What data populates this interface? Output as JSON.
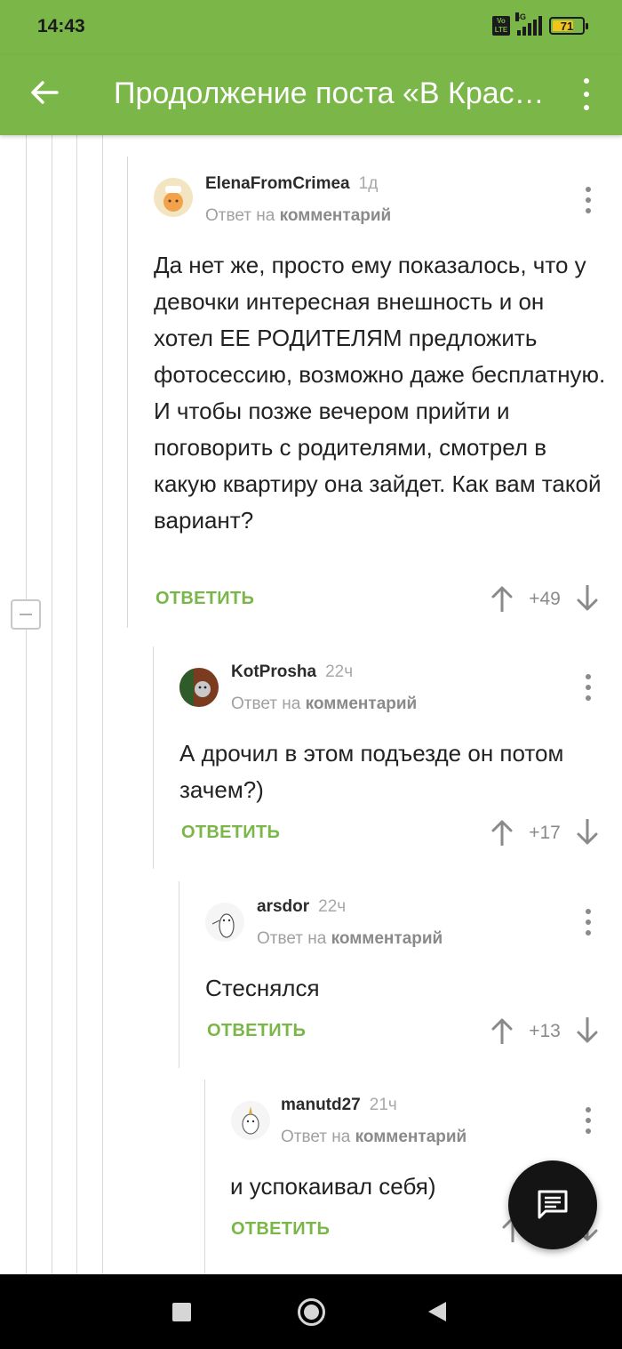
{
  "status_bar": {
    "time": "14:43",
    "volte": "Vo LTE",
    "network": "4G",
    "battery": "71",
    "battery_level": 0.71
  },
  "app_bar": {
    "title": "Продолжение поста «В Краснодаре задержали мужчину, который следил за девочкой»",
    "back_icon": "arrow-left-icon",
    "menu_icon": "more-vert-icon"
  },
  "comments": [
    {
      "author": "ElenaFromCrimea",
      "age": "1д",
      "reply_prefix": "Ответ на",
      "reply_target": "комментарий",
      "text": "Да нет же, просто ему показалось, что у девочки интересная внешность и он хотел ЕЕ РОДИТЕЛЯМ предложить фотосессию, возможно даже бесплатную. И чтобы позже вечером прийти и поговорить с родителями, смотрел в какую квартиру она зайдет. Как вам такой вариант?",
      "reply_label": "ОТВЕТИТЬ",
      "rating": "+49"
    },
    {
      "author": "KotProsha",
      "age": "22ч",
      "reply_prefix": "Ответ на",
      "reply_target": "комментарий",
      "text": "А дрочил в этом подъезде он потом зачем?)",
      "reply_label": "ОТВЕТИТЬ",
      "rating": "+17"
    },
    {
      "author": "arsdor",
      "age": "22ч",
      "reply_prefix": "Ответ на",
      "reply_target": "комментарий",
      "text": "Стеснялся",
      "reply_label": "ОТВЕТИТЬ",
      "rating": "+13"
    },
    {
      "author": "manutd27",
      "age": "21ч",
      "reply_prefix": "Ответ на",
      "reply_target": "комментарий",
      "text": "и успокаивал себя)",
      "reply_label": "ОТВЕТИТЬ",
      "rating": ""
    }
  ],
  "fab": {
    "icon": "comment-icon"
  },
  "nav_bar": {
    "icons": [
      "recents-square-icon",
      "home-circle-icon",
      "back-triangle-icon"
    ]
  },
  "colors": {
    "accent": "#7ab648",
    "text": "#222222",
    "muted": "#a0a0a0"
  }
}
